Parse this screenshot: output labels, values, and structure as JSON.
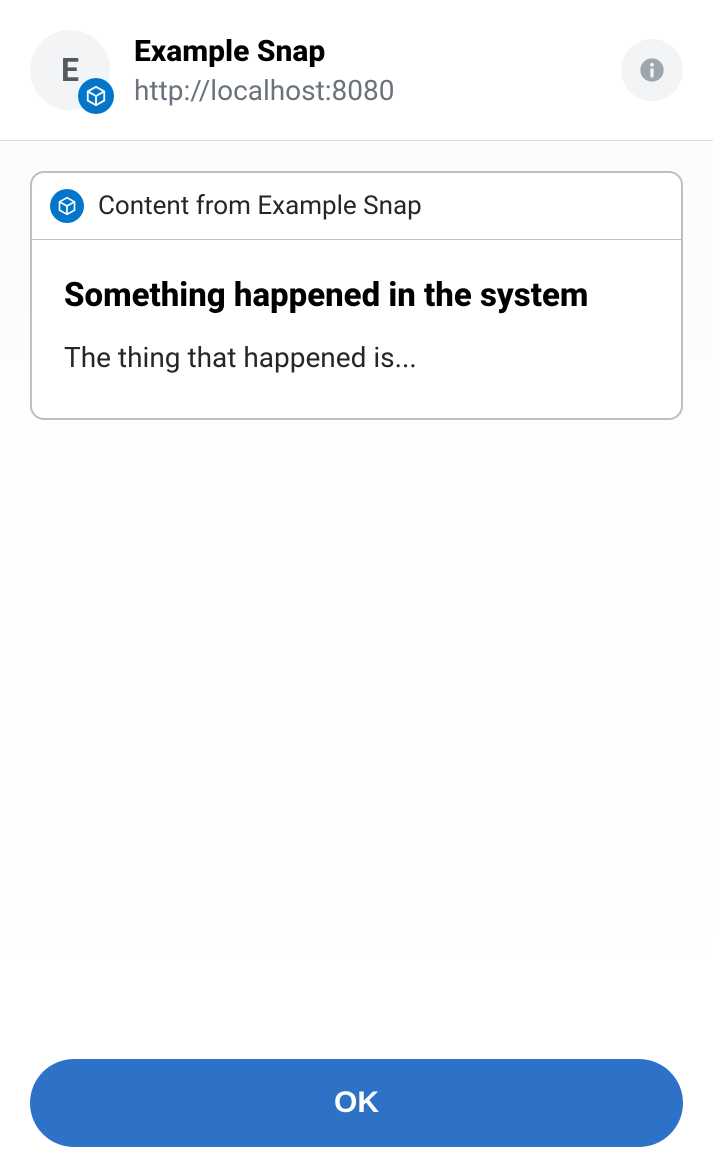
{
  "header": {
    "avatar_letter": "E",
    "title": "Example Snap",
    "subtitle": "http://localhost:8080"
  },
  "card": {
    "source_label": "Content from Example Snap",
    "title": "Something happened in the system",
    "description": "The thing that happened is..."
  },
  "footer": {
    "ok_label": "OK"
  }
}
